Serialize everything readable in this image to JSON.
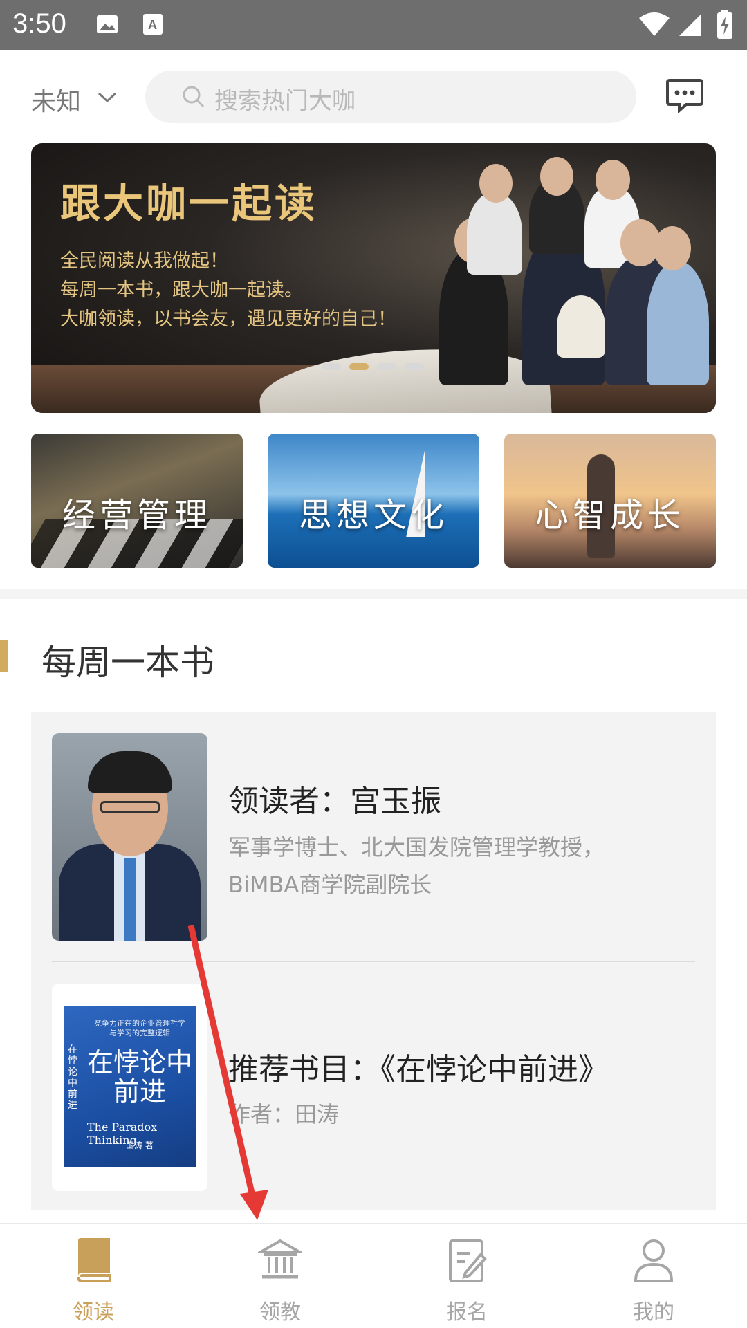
{
  "status_bar": {
    "time": "3:50",
    "icons": [
      "image-icon",
      "font-download-icon",
      "wifi-icon",
      "signal-icon",
      "battery-charging-icon"
    ]
  },
  "header": {
    "location": "未知",
    "search_placeholder": "搜索热门大咖",
    "message_icon": "message-bubble-icon"
  },
  "banner": {
    "title": "跟大咖一起读",
    "lines": [
      "全民阅读从我做起！",
      "每周一本书，跟大咖一起读。",
      "大咖领读，以书会友，遇见更好的自己！"
    ],
    "active_slide": 2,
    "slide_count": 4
  },
  "categories": [
    {
      "label": "经营管理"
    },
    {
      "label": "思想文化"
    },
    {
      "label": "心智成长"
    }
  ],
  "section": {
    "title": "每周一本书"
  },
  "leader": {
    "name": "领读者：宫玉振",
    "desc_line1": "军事学博士、北大国发院管理学教授，",
    "desc_line2": "BiMBA商学院副院长"
  },
  "book": {
    "recommend": "推荐书目：《在悖论中前进》",
    "author": "作者：田涛",
    "cover_title": "在悖论中前进",
    "cover_subtitle": "竞争力正在的企业管理哲学与学习的完整逻辑",
    "cover_en": "The Paradox Thinking",
    "cover_author": "田涛 著",
    "cover_spine": "在悖论中前进"
  },
  "bottom_nav": {
    "items": [
      {
        "label": "领读",
        "icon": "book-icon",
        "active": true
      },
      {
        "label": "领教",
        "icon": "institution-icon",
        "active": false
      },
      {
        "label": "报名",
        "icon": "edit-form-icon",
        "active": false
      },
      {
        "label": "我的",
        "icon": "profile-icon",
        "active": false
      }
    ]
  },
  "colors": {
    "accent": "#c9a05a",
    "inactive": "#a6a6a6",
    "annotation_arrow": "#e53935"
  }
}
